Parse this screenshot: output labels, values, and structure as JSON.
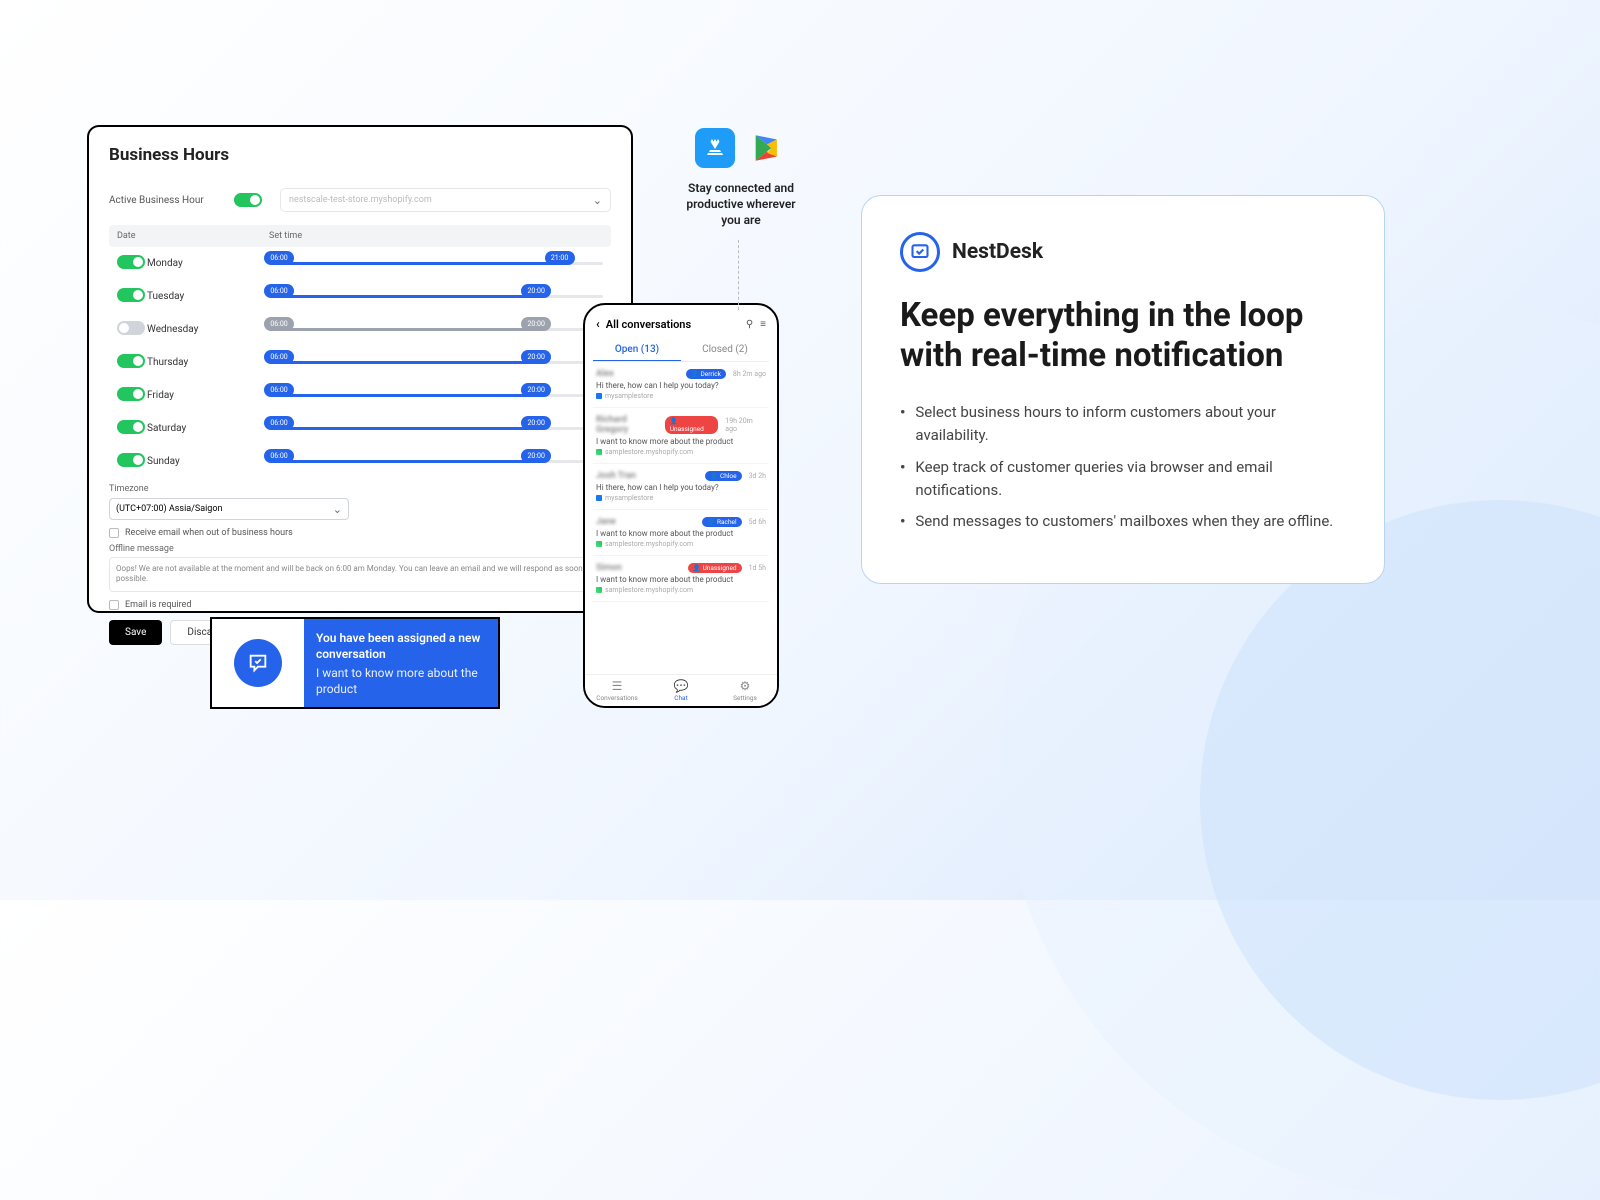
{
  "business_hours": {
    "title": "Business Hours",
    "active_label": "Active Business Hour",
    "store": "nestscale-test-store.myshopify.com",
    "col_date": "Date",
    "col_settime": "Set time",
    "days": [
      {
        "name": "Monday",
        "on": true,
        "start": "06:00",
        "end": "21:00",
        "s": 3,
        "e": 87
      },
      {
        "name": "Tuesday",
        "on": true,
        "start": "06:00",
        "end": "20:00",
        "s": 3,
        "e": 80
      },
      {
        "name": "Wednesday",
        "on": false,
        "start": "06:00",
        "end": "20:00",
        "s": 3,
        "e": 80
      },
      {
        "name": "Thursday",
        "on": true,
        "start": "06:00",
        "end": "20:00",
        "s": 3,
        "e": 80
      },
      {
        "name": "Friday",
        "on": true,
        "start": "06:00",
        "end": "20:00",
        "s": 3,
        "e": 80
      },
      {
        "name": "Saturday",
        "on": true,
        "start": "06:00",
        "end": "20:00",
        "s": 3,
        "e": 80
      },
      {
        "name": "Sunday",
        "on": true,
        "start": "06:00",
        "end": "20:00",
        "s": 3,
        "e": 80
      }
    ],
    "tz_label": "Timezone",
    "tz_value": "(UTC+07:00) Assia/Saigon",
    "email_oob": "Receive email when out of business hours",
    "offline_label": "Offline message",
    "offline_msg": "Oops! We are not available at the moment and will be back on 6:00 am Monday. You can leave an email and we will respond as soon as possible.",
    "email_required": "Email is required",
    "save": "Save",
    "discard": "Discard"
  },
  "toast": {
    "title": "You have been assigned a new conversation",
    "sub": "I want to know more about the product"
  },
  "phone": {
    "title": "All conversations",
    "tab_open": "Open (13)",
    "tab_closed": "Closed (2)",
    "convs": [
      {
        "name": "Alex",
        "badge": "Derrick",
        "badge_class": "blue",
        "time": "8h 2m ago",
        "msg": "Hi there, how can I help you today?",
        "src": "mysamplestore",
        "icon": "fb"
      },
      {
        "name": "Richard Gregory",
        "badge": "Unassigned",
        "badge_class": "red",
        "time": "19h 20m ago",
        "msg": "I want to know more about the product",
        "src": "samplestore.myshopify.com",
        "icon": "sh"
      },
      {
        "name": "Josh Tran",
        "badge": "Chloe",
        "badge_class": "blue",
        "time": "3d 2h",
        "msg": "Hi there, how can I help you today?",
        "src": "mysamplestore",
        "icon": "fb"
      },
      {
        "name": "Jane",
        "badge": "Rachel",
        "badge_class": "blue",
        "time": "5d 6h",
        "msg": "I want to know more about the product",
        "src": "samplestore.myshopify.com",
        "icon": "sh"
      },
      {
        "name": "Simon",
        "badge": "Unassigned",
        "badge_class": "red",
        "time": "1d 5h",
        "msg": "I want to know more about the product",
        "src": "samplestore.myshopify.com",
        "icon": "sh"
      }
    ],
    "nav": [
      {
        "label": "Conversations"
      },
      {
        "label": "Chat"
      },
      {
        "label": "Settings"
      }
    ]
  },
  "stores": {
    "caption": "Stay connected and productive wherever you are"
  },
  "card": {
    "brand": "NestDesk",
    "headline": "Keep everything in the loop with real-time notification",
    "bullets": [
      "Select business hours to inform customers about your availability.",
      "Keep track of customer queries via browser and email notifications.",
      "Send messages to customers' mailboxes when they are offline."
    ]
  }
}
